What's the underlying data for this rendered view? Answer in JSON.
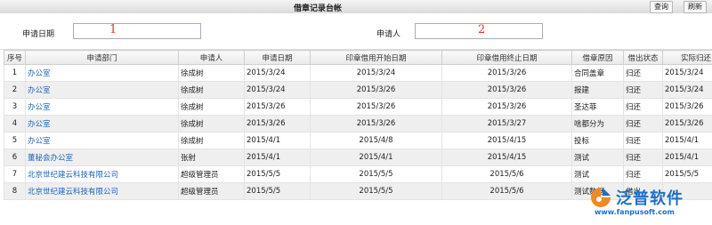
{
  "header": {
    "title": "借章记录台帐",
    "query_label": "查询",
    "refresh_label": "刷新"
  },
  "filters": {
    "apply_date_label": "申请日期",
    "applicant_label": "申请人",
    "annotation_1": "1",
    "annotation_2": "2"
  },
  "table": {
    "columns": [
      "序号",
      "申请部门",
      "申请人",
      "申请日期",
      "印章借用开始日期",
      "印章借用终止日期",
      "借章原因",
      "借出状态",
      "实际归还日期"
    ],
    "rows": [
      [
        "1",
        "办公室",
        "徐成树",
        "2015/3/24",
        "2015/3/24",
        "2015/3/26",
        "合同盖章",
        "归还",
        "2015/3/24"
      ],
      [
        "2",
        "办公室",
        "徐成树",
        "2015/3/24",
        "2015/3/26",
        "2015/3/26",
        "报建",
        "归还",
        "2015/3/24"
      ],
      [
        "3",
        "办公室",
        "徐成树",
        "2015/3/26",
        "2015/3/26",
        "2015/3/26",
        "圣达菲",
        "归还",
        "2015/3/26"
      ],
      [
        "4",
        "办公室",
        "徐成树",
        "2015/3/26",
        "2015/3/26",
        "2015/3/27",
        "啥都分为",
        "归还",
        "2015/3/26"
      ],
      [
        "5",
        "办公室",
        "徐成树",
        "2015/4/1",
        "2015/4/8",
        "2015/4/15",
        "投标",
        "归还",
        "2015/4/1"
      ],
      [
        "6",
        "董秘会办公室",
        "张射",
        "2015/4/1",
        "2015/4/1",
        "2015/4/15",
        "测试",
        "归还",
        "2015/4/1"
      ],
      [
        "7",
        "北京世纪建云科技有限公司",
        "超级管理员",
        "2015/5/5",
        "2015/5/5",
        "2015/5/6",
        "测试",
        "归还",
        "2015/5/5"
      ],
      [
        "8",
        "北京世纪建云科技有限公司",
        "超级管理员",
        "2015/5/5",
        "2015/5/5",
        "2015/5/6",
        "测试数据",
        "借出",
        ""
      ]
    ]
  },
  "watermark": {
    "brand": "泛普软件",
    "url": "www.fanpusoft.com"
  }
}
